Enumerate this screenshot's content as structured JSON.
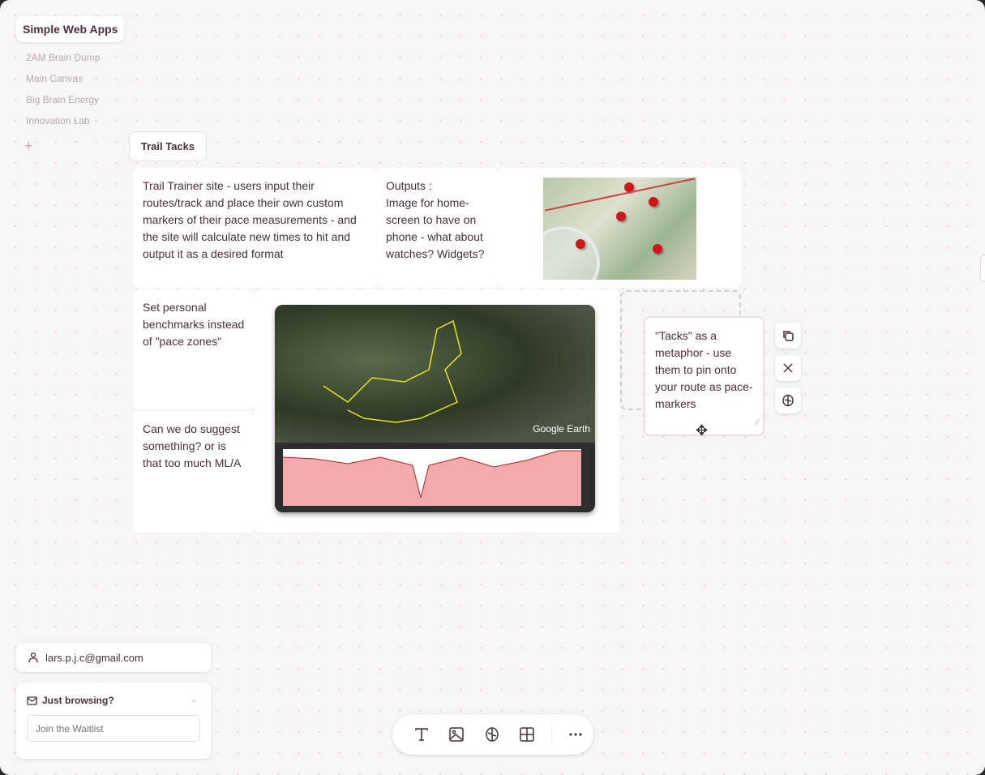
{
  "sidebar": {
    "workspace": "Simple Web Apps",
    "boards": [
      "2AM Brain Dump",
      "Main Canvas",
      "Big Brain Energy",
      "Innovation Lab"
    ],
    "add_icon": "plus-icon"
  },
  "board": {
    "title": "Trail Tacks",
    "notes": {
      "trail_trainer": "Trail Trainer site - users input their routes/track and place their own custom markers of their pace measurements - and the site will calculate new times to hit and output it as a desired format",
      "outputs": "Outputs :\nImage for home-screen to have on phone - what about watches? Widgets?",
      "benchmarks": "Set personal benchmarks instead of \"pace zones\"",
      "suggest": "Can we do suggest something? or is that too much ML/A",
      "tacks": "\"Tacks\" as a metaphor - use them to pin onto your route as pace-markers"
    },
    "images": {
      "map_pins": "map with red push pins and compass",
      "earth": "Google Earth"
    },
    "note_actions": [
      "copy-icon",
      "close-icon",
      "brain-icon"
    ]
  },
  "account": {
    "email": "lars.p.j.c@gmail.com"
  },
  "waitlist": {
    "title": "Just browsing?",
    "placeholder": "Join the Waitlist"
  },
  "toolbar": {
    "tools": [
      "text-icon",
      "image-icon",
      "brain-icon",
      "grid-icon",
      "more-icon"
    ]
  }
}
